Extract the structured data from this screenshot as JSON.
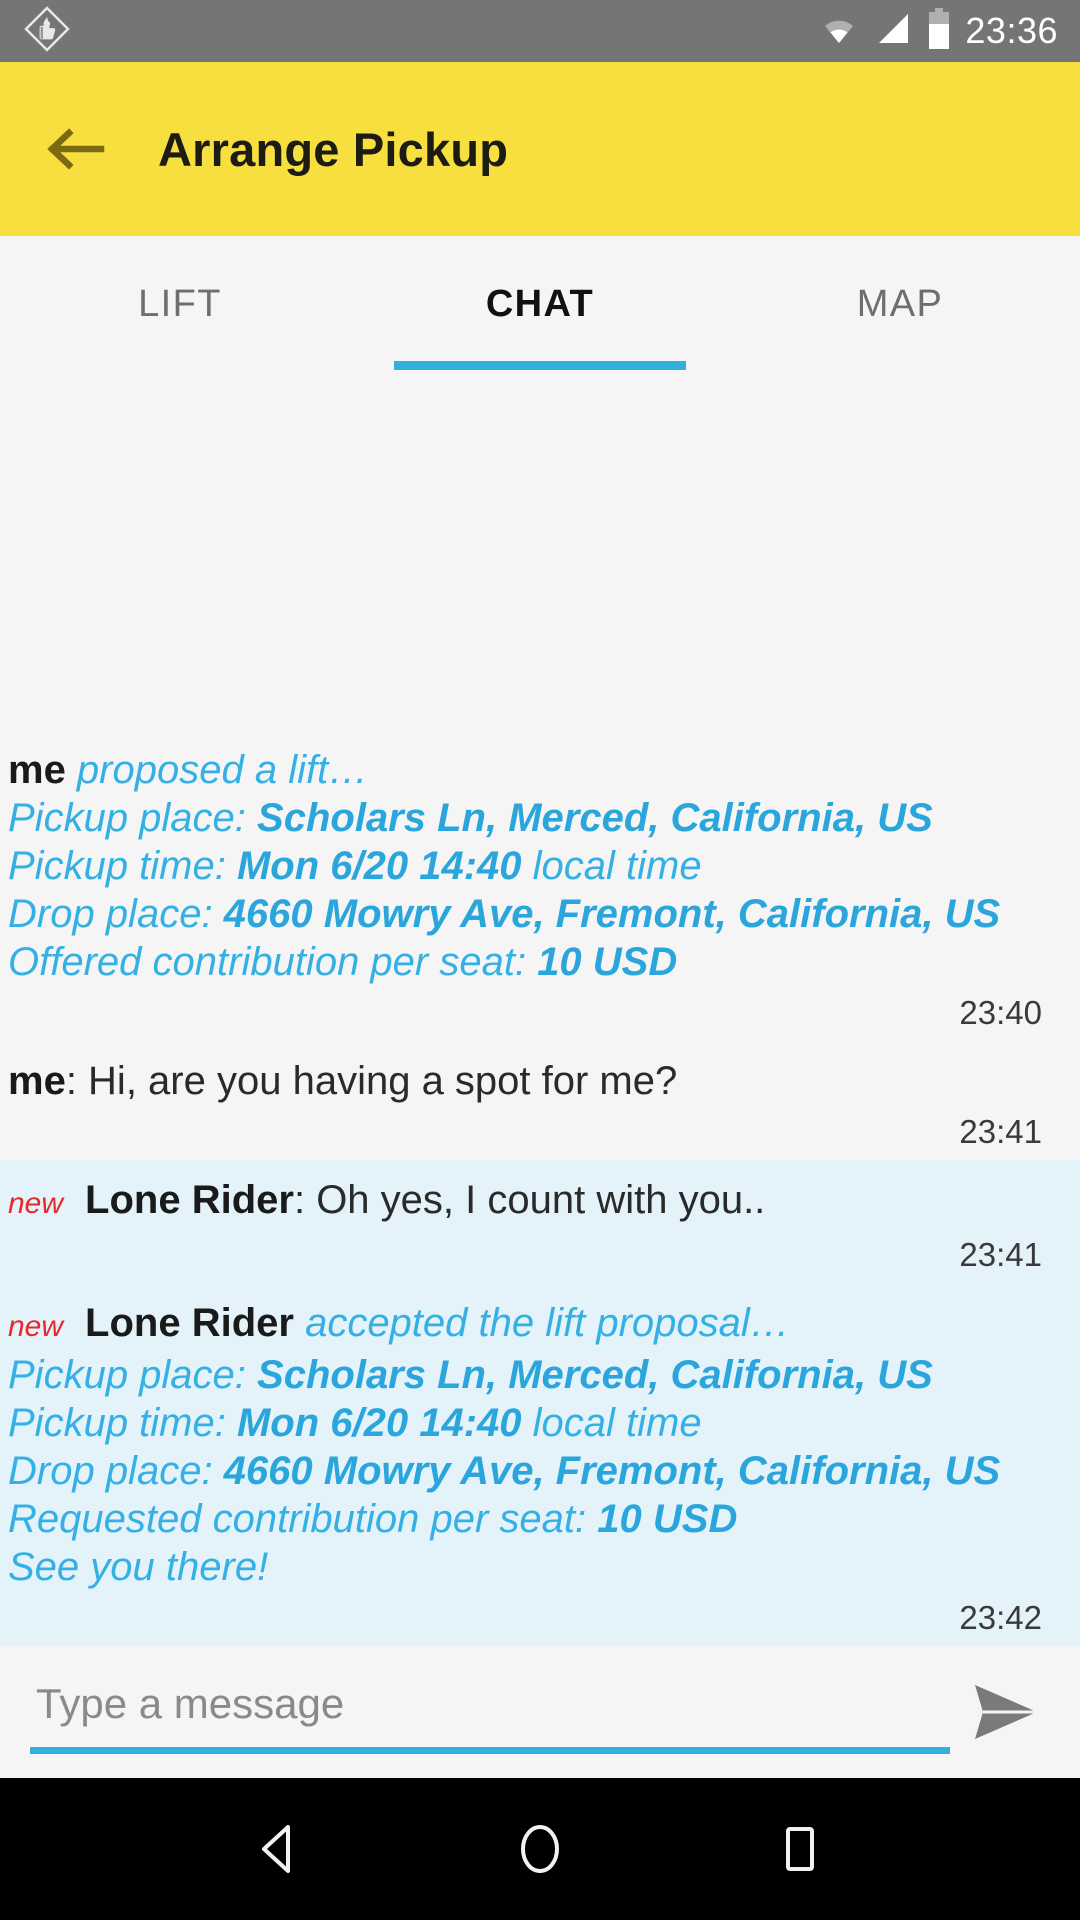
{
  "status_bar": {
    "app_icon": "thumbs-up-diamond-icon",
    "icons": [
      "wifi-icon",
      "cellular-signal-icon",
      "battery-icon"
    ],
    "clock": "23:36"
  },
  "app_bar": {
    "back_icon": "back-arrow-icon",
    "title": "Arrange Pickup",
    "background": "#f7df3f"
  },
  "tabs": {
    "items": [
      {
        "label": "LIFT",
        "active": false
      },
      {
        "label": "CHAT",
        "active": true
      },
      {
        "label": "MAP",
        "active": false
      }
    ],
    "indicator_color": "#31b0e0"
  },
  "chat": {
    "incoming_background": "#e4f2fa",
    "outgoing_background": "#f5f5f5",
    "accent_blue": "#34b0e4",
    "new_badge_color": "#e8272b",
    "messages": [
      {
        "type": "proposal",
        "direction": "out",
        "sender": "me",
        "action": "proposed a lift…",
        "fields": [
          {
            "label": "Pickup place: ",
            "value": "Scholars Ln, Merced, California, US",
            "suffix": ""
          },
          {
            "label": "Pickup time: ",
            "value": "Mon 6/20 14:40",
            "suffix": " local time"
          },
          {
            "label": "Drop place: ",
            "value": "4660 Mowry Ave, Fremont, California, US",
            "suffix": ""
          },
          {
            "label": "Offered contribution per seat: ",
            "value": "10 USD",
            "suffix": ""
          }
        ],
        "footer": "",
        "time": "23:40"
      },
      {
        "type": "text",
        "direction": "out",
        "sender": "me",
        "separator": ": ",
        "text": "Hi, are you having a spot for me?",
        "time": "23:41"
      },
      {
        "type": "text",
        "direction": "in",
        "badge": "new",
        "sender": "Lone Rider",
        "separator": ": ",
        "text": "Oh yes, I count with you..",
        "time": "23:41"
      },
      {
        "type": "proposal",
        "direction": "in",
        "badge": "new",
        "sender": "Lone Rider",
        "action": " accepted the lift proposal…",
        "fields": [
          {
            "label": "Pickup place: ",
            "value": "Scholars Ln, Merced, California, US",
            "suffix": ""
          },
          {
            "label": "Pickup time: ",
            "value": "Mon 6/20 14:40",
            "suffix": " local time"
          },
          {
            "label": "Drop place: ",
            "value": "4660 Mowry Ave, Fremont, California, US",
            "suffix": ""
          },
          {
            "label": "Requested contribution per seat: ",
            "value": "10 USD",
            "suffix": ""
          }
        ],
        "footer": "See you there!",
        "time": "23:42"
      }
    ]
  },
  "composer": {
    "placeholder": "Type a message",
    "value": "",
    "send_icon": "send-paper-plane-icon",
    "underline_color": "#31b0e0"
  },
  "nav_bar": {
    "back_icon": "nav-back-triangle-icon",
    "home_icon": "nav-home-circle-icon",
    "recents_icon": "nav-recents-square-icon"
  }
}
